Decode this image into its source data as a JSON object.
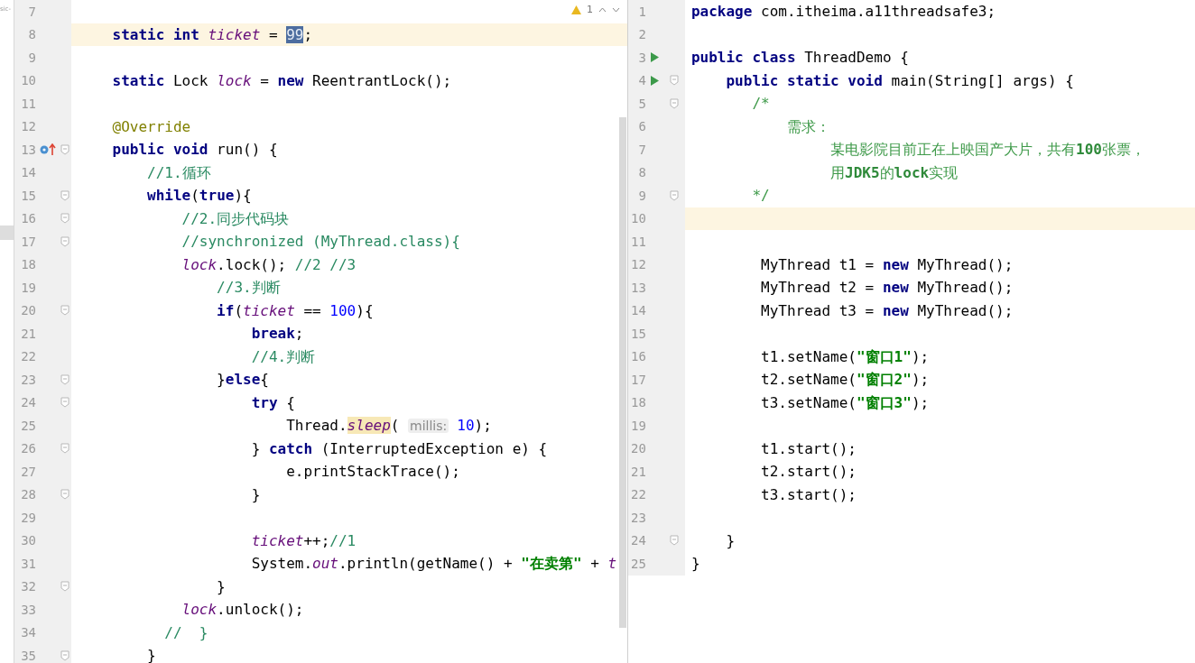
{
  "side_strip": {
    "text": "sic-"
  },
  "inspection": {
    "count": "1"
  },
  "panes": [
    {
      "lines": [
        {
          "number": "7",
          "current": false
        },
        {
          "number": "8",
          "current": true,
          "tokens": [
            {
              "text": "    static int ",
              "kind": "keyword"
            },
            {
              "text": "ticket",
              "kind": "field"
            },
            {
              "text": " = ",
              "kind": "plain"
            },
            {
              "text": "99",
              "kind": "selection"
            },
            {
              "text": ";",
              "kind": "plain"
            }
          ]
        },
        {
          "number": "9",
          "current": false
        },
        {
          "number": "10",
          "current": false,
          "tokens": [
            {
              "text": "    static ",
              "kind": "keyword"
            },
            {
              "text": "Lock ",
              "kind": "plain"
            },
            {
              "text": "lock",
              "kind": "field"
            },
            {
              "text": " = ",
              "kind": "plain"
            },
            {
              "text": "new",
              "kind": "keyword"
            },
            {
              "text": " ReentrantLock();",
              "kind": "plain"
            }
          ]
        },
        {
          "number": "11",
          "current": false
        },
        {
          "number": "12",
          "current": false,
          "tokens": [
            {
              "text": "    @Override",
              "kind": "annotation"
            }
          ]
        },
        {
          "number": "13",
          "current": false,
          "override_marker": true,
          "foldable": true,
          "tokens": [
            {
              "text": "    public void ",
              "kind": "keyword"
            },
            {
              "text": "run() {",
              "kind": "plain"
            }
          ]
        },
        {
          "number": "14",
          "current": false,
          "tokens": [
            {
              "text": "        //1.循环",
              "kind": "comment"
            }
          ]
        },
        {
          "number": "15",
          "current": false,
          "foldable": true,
          "tokens": [
            {
              "text": "        while",
              "kind": "keyword"
            },
            {
              "text": "(",
              "kind": "plain"
            },
            {
              "text": "true",
              "kind": "keyword"
            },
            {
              "text": "){",
              "kind": "plain"
            }
          ]
        },
        {
          "number": "16",
          "current": false,
          "foldable": true,
          "tokens": [
            {
              "text": "            //2.同步代码块",
              "kind": "comment"
            }
          ]
        },
        {
          "number": "17",
          "current": false,
          "foldable": true,
          "tokens": [
            {
              "text": "            //synchronized (MyThread.class){",
              "kind": "comment"
            }
          ]
        },
        {
          "number": "18",
          "current": false,
          "tokens": [
            {
              "text": "            lock",
              "kind": "field"
            },
            {
              "text": ".lock(); ",
              "kind": "plain"
            },
            {
              "text": "//2 //3",
              "kind": "comment"
            }
          ]
        },
        {
          "number": "19",
          "current": false,
          "tokens": [
            {
              "text": "                //3.判断",
              "kind": "comment"
            }
          ]
        },
        {
          "number": "20",
          "current": false,
          "foldable": true,
          "tokens": [
            {
              "text": "                if",
              "kind": "keyword"
            },
            {
              "text": "(",
              "kind": "plain"
            },
            {
              "text": "ticket",
              "kind": "field"
            },
            {
              "text": " == ",
              "kind": "plain"
            },
            {
              "text": "100",
              "kind": "number"
            },
            {
              "text": "){",
              "kind": "plain"
            }
          ]
        },
        {
          "number": "21",
          "current": false,
          "tokens": [
            {
              "text": "                    break",
              "kind": "keyword"
            },
            {
              "text": ";",
              "kind": "plain"
            }
          ]
        },
        {
          "number": "22",
          "current": false,
          "tokens": [
            {
              "text": "                    //4.判断",
              "kind": "comment"
            }
          ]
        },
        {
          "number": "23",
          "current": false,
          "foldable": true,
          "tokens": [
            {
              "text": "                }",
              "kind": "plain"
            },
            {
              "text": "else",
              "kind": "keyword"
            },
            {
              "text": "{",
              "kind": "plain"
            }
          ]
        },
        {
          "number": "24",
          "current": false,
          "foldable": true,
          "tokens": [
            {
              "text": "                    try",
              "kind": "keyword"
            },
            {
              "text": " {",
              "kind": "plain"
            }
          ]
        },
        {
          "number": "25",
          "current": false,
          "tokens": [
            {
              "text": "                        Thread.",
              "kind": "plain"
            },
            {
              "text": "sleep",
              "kind": "usage"
            },
            {
              "text": "( ",
              "kind": "plain"
            },
            {
              "text": "millis:",
              "kind": "hint"
            },
            {
              "text": "10",
              "kind": "number"
            },
            {
              "text": ");",
              "kind": "plain"
            }
          ]
        },
        {
          "number": "26",
          "current": false,
          "foldable": true,
          "tokens": [
            {
              "text": "                    } ",
              "kind": "plain"
            },
            {
              "text": "catch",
              "kind": "keyword"
            },
            {
              "text": " (InterruptedException e) {",
              "kind": "plain"
            }
          ]
        },
        {
          "number": "27",
          "current": false,
          "tokens": [
            {
              "text": "                        e.printStackTrace();",
              "kind": "plain"
            }
          ]
        },
        {
          "number": "28",
          "current": false,
          "foldable": true,
          "tokens": [
            {
              "text": "                    }",
              "kind": "plain"
            }
          ]
        },
        {
          "number": "29",
          "current": false
        },
        {
          "number": "30",
          "current": false,
          "tokens": [
            {
              "text": "                    ticket",
              "kind": "field"
            },
            {
              "text": "++;",
              "kind": "plain"
            },
            {
              "text": "//1",
              "kind": "comment"
            }
          ]
        },
        {
          "number": "31",
          "current": false,
          "tokens": [
            {
              "text": "                    System.",
              "kind": "plain"
            },
            {
              "text": "out",
              "kind": "field"
            },
            {
              "text": ".println(getName() + ",
              "kind": "plain"
            },
            {
              "text": "\"在卖第\"",
              "kind": "string"
            },
            {
              "text": " + ",
              "kind": "plain"
            },
            {
              "text": "t",
              "kind": "field"
            }
          ]
        },
        {
          "number": "32",
          "current": false,
          "foldable": true,
          "tokens": [
            {
              "text": "                }",
              "kind": "plain"
            }
          ]
        },
        {
          "number": "33",
          "current": false,
          "tokens": [
            {
              "text": "            lock",
              "kind": "field"
            },
            {
              "text": ".unlock();",
              "kind": "plain"
            }
          ]
        },
        {
          "number": "34",
          "current": false,
          "tokens": [
            {
              "text": "          //  }",
              "kind": "comment"
            }
          ]
        },
        {
          "number": "35",
          "current": false,
          "foldable": true,
          "tokens": [
            {
              "text": "        }",
              "kind": "plain"
            }
          ]
        }
      ]
    },
    {
      "lines": [
        {
          "number": "1",
          "current": false,
          "tokens": [
            {
              "text": "package",
              "kind": "keyword"
            },
            {
              "text": " com.itheima.a11threadsafe3;",
              "kind": "plain"
            }
          ]
        },
        {
          "number": "2",
          "current": false
        },
        {
          "number": "3",
          "current": false,
          "run_marker": true,
          "tokens": [
            {
              "text": "public class ",
              "kind": "keyword"
            },
            {
              "text": "ThreadDemo {",
              "kind": "plain"
            }
          ]
        },
        {
          "number": "4",
          "current": false,
          "run_marker": true,
          "foldable": true,
          "tokens": [
            {
              "text": "    public static void ",
              "kind": "keyword"
            },
            {
              "text": "main(String[] args) {",
              "kind": "plain"
            }
          ]
        },
        {
          "number": "5",
          "current": false,
          "foldable": true,
          "tokens": [
            {
              "text": "       /*",
              "kind": "doc"
            }
          ]
        },
        {
          "number": "6",
          "current": false,
          "tokens": [
            {
              "text": "           需求：",
              "kind": "doc"
            }
          ]
        },
        {
          "number": "7",
          "current": false,
          "tokens": [
            {
              "text": "                某电影院目前正在上映国产大片，共有",
              "kind": "doc"
            },
            {
              "text": "100",
              "kind": "docbold"
            },
            {
              "text": "张票，",
              "kind": "doc"
            }
          ]
        },
        {
          "number": "8",
          "current": false,
          "tokens": [
            {
              "text": "                用",
              "kind": "doc"
            },
            {
              "text": "JDK5",
              "kind": "docbold"
            },
            {
              "text": "的",
              "kind": "doc"
            },
            {
              "text": "lock",
              "kind": "docbold"
            },
            {
              "text": "实现",
              "kind": "doc"
            }
          ]
        },
        {
          "number": "9",
          "current": false,
          "foldable": true,
          "tokens": [
            {
              "text": "       */",
              "kind": "doc"
            }
          ]
        },
        {
          "number": "10",
          "current": true
        },
        {
          "number": "11",
          "current": false
        },
        {
          "number": "12",
          "current": false,
          "tokens": [
            {
              "text": "        MyThread t1 = ",
              "kind": "plain"
            },
            {
              "text": "new",
              "kind": "keyword"
            },
            {
              "text": " MyThread();",
              "kind": "plain"
            }
          ]
        },
        {
          "number": "13",
          "current": false,
          "tokens": [
            {
              "text": "        MyThread t2 = ",
              "kind": "plain"
            },
            {
              "text": "new",
              "kind": "keyword"
            },
            {
              "text": " MyThread();",
              "kind": "plain"
            }
          ]
        },
        {
          "number": "14",
          "current": false,
          "tokens": [
            {
              "text": "        MyThread t3 = ",
              "kind": "plain"
            },
            {
              "text": "new",
              "kind": "keyword"
            },
            {
              "text": " MyThread();",
              "kind": "plain"
            }
          ]
        },
        {
          "number": "15",
          "current": false
        },
        {
          "number": "16",
          "current": false,
          "tokens": [
            {
              "text": "        t1.setName(",
              "kind": "plain"
            },
            {
              "text": "\"窗口1\"",
              "kind": "string"
            },
            {
              "text": ");",
              "kind": "plain"
            }
          ]
        },
        {
          "number": "17",
          "current": false,
          "tokens": [
            {
              "text": "        t2.setName(",
              "kind": "plain"
            },
            {
              "text": "\"窗口2\"",
              "kind": "string"
            },
            {
              "text": ");",
              "kind": "plain"
            }
          ]
        },
        {
          "number": "18",
          "current": false,
          "tokens": [
            {
              "text": "        t3.setName(",
              "kind": "plain"
            },
            {
              "text": "\"窗口3\"",
              "kind": "string"
            },
            {
              "text": ");",
              "kind": "plain"
            }
          ]
        },
        {
          "number": "19",
          "current": false
        },
        {
          "number": "20",
          "current": false,
          "tokens": [
            {
              "text": "        t1.start();",
              "kind": "plain"
            }
          ]
        },
        {
          "number": "21",
          "current": false,
          "tokens": [
            {
              "text": "        t2.start();",
              "kind": "plain"
            }
          ]
        },
        {
          "number": "22",
          "current": false,
          "tokens": [
            {
              "text": "        t3.start();",
              "kind": "plain"
            }
          ]
        },
        {
          "number": "23",
          "current": false
        },
        {
          "number": "24",
          "current": false,
          "foldable": true,
          "tokens": [
            {
              "text": "    }",
              "kind": "plain"
            }
          ]
        },
        {
          "number": "25",
          "current": false,
          "tokens": [
            {
              "text": "}",
              "kind": "plain"
            }
          ]
        }
      ]
    }
  ]
}
